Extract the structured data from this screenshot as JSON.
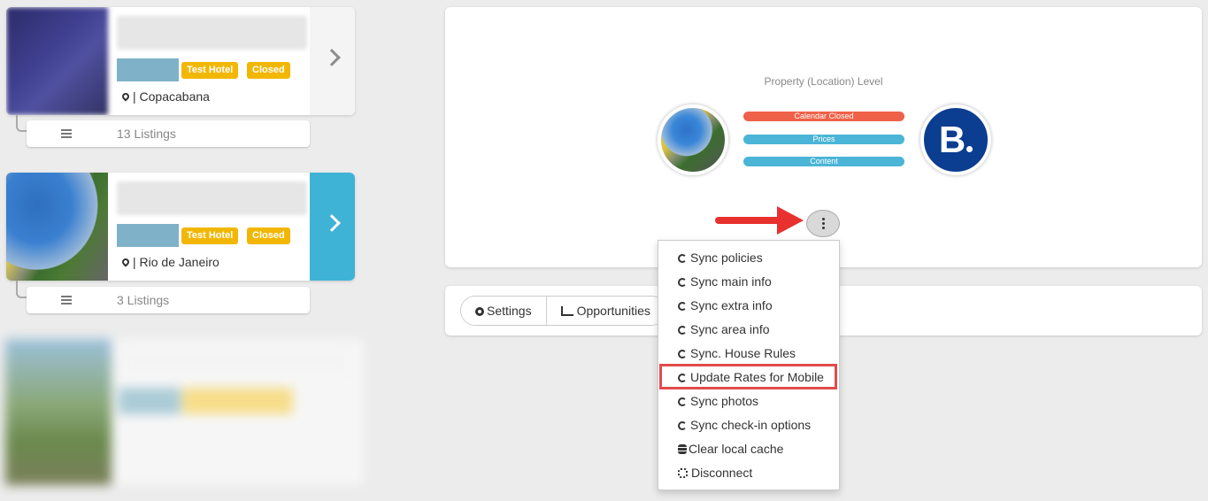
{
  "hotels": [
    {
      "badge_test": "Test Hotel",
      "badge_closed": "Closed",
      "location": "| Copacabana",
      "listings": "13 Listings"
    },
    {
      "badge_test": "Test Hotel",
      "badge_closed": "Closed",
      "location": "| Rio de Janeiro",
      "listings": "3 Listings"
    }
  ],
  "main": {
    "level_title": "Property (Location) Level",
    "pills": [
      "Calendar Closed",
      "Prices",
      "Content"
    ],
    "booking_letter": "B"
  },
  "tabs": [
    {
      "label": "Settings",
      "icon": "gear-icon"
    },
    {
      "label": "Opportunities",
      "icon": "trend-chart-icon"
    }
  ],
  "menu": [
    {
      "label": "Sync policies",
      "icon": "refresh-icon"
    },
    {
      "label": "Sync main info",
      "icon": "refresh-icon"
    },
    {
      "label": "Sync extra info",
      "icon": "refresh-icon"
    },
    {
      "label": "Sync area info",
      "icon": "refresh-icon"
    },
    {
      "label": "Sync. House Rules",
      "icon": "refresh-icon"
    },
    {
      "label": "Update Rates for Mobile",
      "icon": "refresh-icon"
    },
    {
      "label": "Sync photos",
      "icon": "refresh-icon"
    },
    {
      "label": "Sync check-in options",
      "icon": "refresh-icon"
    },
    {
      "label": "Clear local cache",
      "icon": "database-icon"
    },
    {
      "label": "Disconnect",
      "icon": "unlink-icon"
    }
  ],
  "colors": {
    "accent": "#3fb3d6",
    "badge": "#f2b705",
    "booking": "#0b3d91",
    "pill_red": "#ef6148",
    "pill_blue": "#4ab5d6",
    "arrow": "#e8312f"
  }
}
